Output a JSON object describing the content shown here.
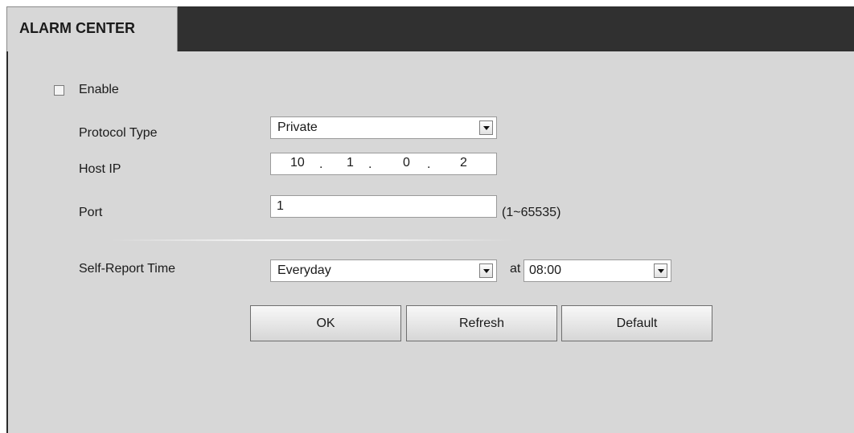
{
  "tab": {
    "title": "ALARM CENTER"
  },
  "form": {
    "enable_label": "Enable",
    "enable_checked": false,
    "protocol_label": "Protocol Type",
    "protocol_value": "Private",
    "host_label": "Host IP",
    "host_ip": [
      "10",
      "1",
      "0",
      "2"
    ],
    "port_label": "Port",
    "port_value": "1",
    "port_range": "(1~65535)",
    "report_label": "Self-Report Time",
    "report_period": "Everyday",
    "at_label": "at",
    "report_time": "08:00"
  },
  "buttons": {
    "ok": "OK",
    "refresh": "Refresh",
    "default": "Default"
  },
  "colors": {
    "background": "#d7d7d7",
    "header": "#303030"
  },
  "icons": [
    "dropdown-arrow-icon"
  ]
}
